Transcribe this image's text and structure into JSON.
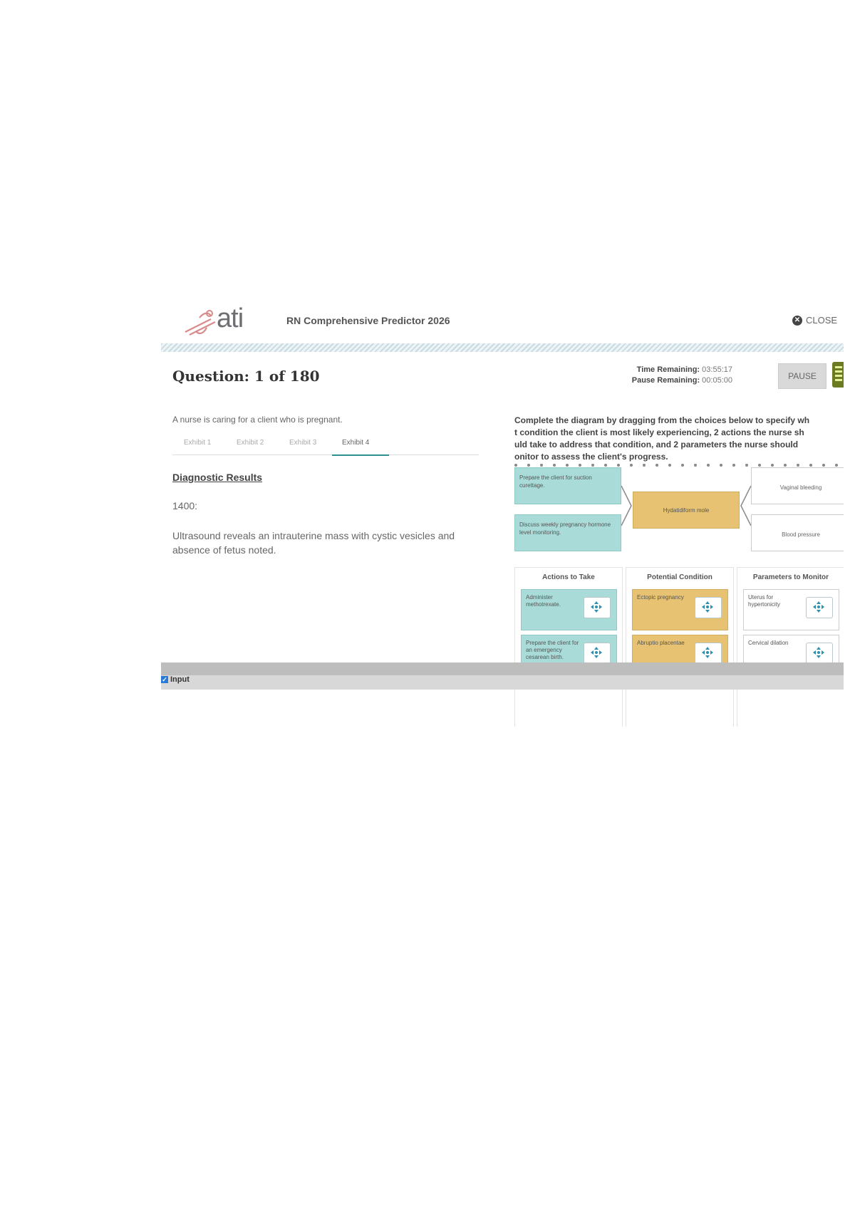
{
  "header": {
    "logo_text": "ati",
    "title": "RN Comprehensive Predictor 2026",
    "close_label": "CLOSE"
  },
  "question": {
    "label": "Question: 1 of 180",
    "time_remaining_label": "Time Remaining:",
    "time_remaining_value": "03:55:17",
    "pause_remaining_label": "Pause Remaining:",
    "pause_remaining_value": "00:05:00",
    "pause_button": "PAUSE"
  },
  "left": {
    "stem": "A nurse is caring for a client who is pregnant.",
    "tabs": [
      "Exhibit 1",
      "Exhibit 2",
      "Exhibit 3",
      "Exhibit 4"
    ],
    "active_tab": 3,
    "section_title": "Diagnostic Results",
    "time_entry": "1400:",
    "finding": "Ultrasound reveals an intrauterine mass with cystic vesicles and absence of fetus noted."
  },
  "right": {
    "instructions": [
      "Complete the diagram by dragging from the choices below to specify wh",
      "t condition the client is most likely experiencing, 2 actions the nurse sh",
      "uld take to address that condition, and 2 parameters the nurse should",
      "onitor to assess the client's progress."
    ],
    "diagram": {
      "action_1": "Prepare the client for suction curettage.",
      "action_2": "Discuss weekly pregnancy hormone level monitoring.",
      "condition": "Hydatidiform mole",
      "parameter_1": "Vaginal bleeding",
      "parameter_2": "Blood pressure"
    },
    "columns": {
      "actions_header": "Actions to Take",
      "conditions_header": "Potential Condition",
      "parameters_header": "Parameters to Monitor",
      "actions": [
        "Administer methotrexate.",
        "Prepare the client for an emergency cesarean birth."
      ],
      "conditions": [
        "Ectopic pregnancy",
        "Abruptio placentae"
      ],
      "parameters": [
        "Uterus for hypertonicity",
        "Cervical dilation"
      ]
    },
    "colors": {
      "teal": "#a9dcd8",
      "gold": "#e6c272",
      "accent": "#2f8e8e"
    }
  },
  "footer": {
    "input_label": "Input"
  }
}
